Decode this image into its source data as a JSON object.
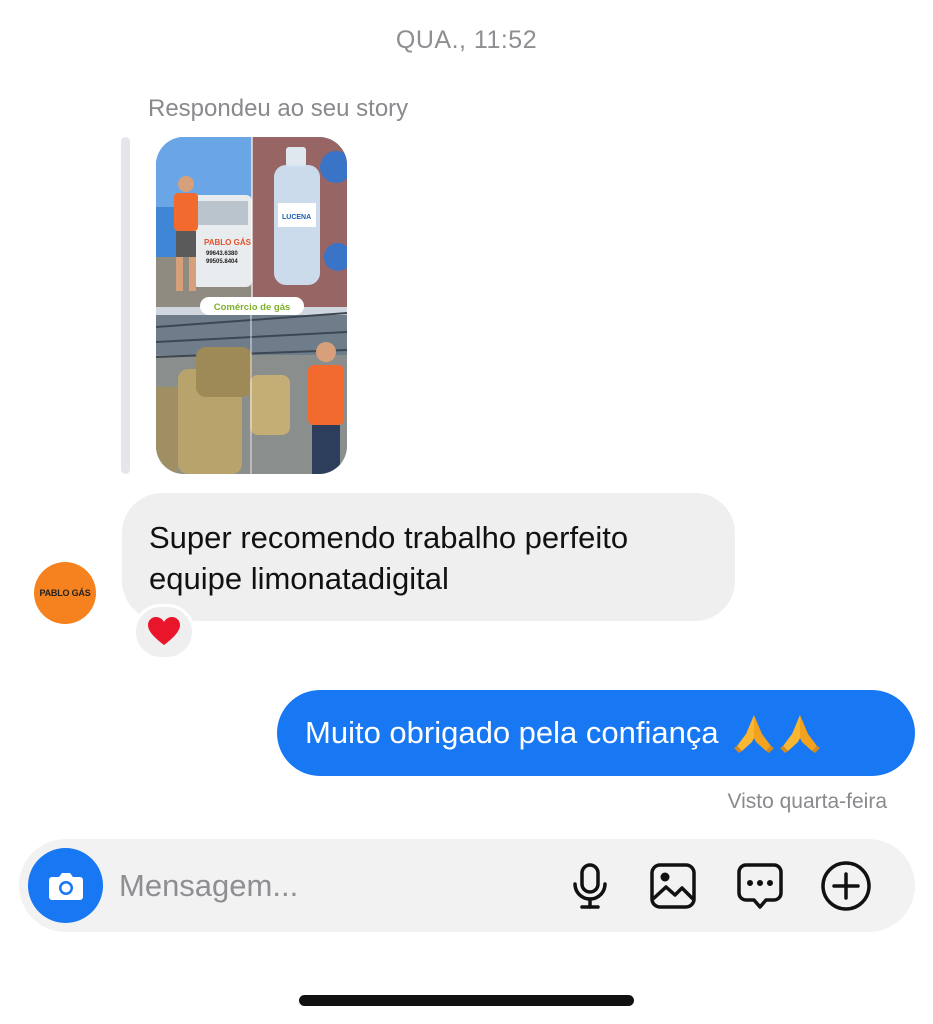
{
  "thread": {
    "timestamp": "QUA., 11:52",
    "story_reply": {
      "caption": "Respondeu ao seu story",
      "thumbnail_text": {
        "van_brand": "PABLO GÁS",
        "van_phone_1": "99643.6380",
        "van_phone_2": "99505.8404",
        "bottle_label": "LUCENA",
        "banner": "Comércio de gás"
      }
    },
    "incoming": {
      "avatar_label": "PABLO GÁS",
      "text": "Super recomendo trabalho perfeito equipe limonatadigital",
      "reaction": "heart"
    },
    "outgoing": {
      "text": "Muito obrigado pela confiança",
      "emoji": "folded-hands folded-hands",
      "status": "Visto quarta-feira"
    }
  },
  "composer": {
    "placeholder": "Mensagem...",
    "camera_icon": "camera-icon",
    "tools": [
      "microphone-icon",
      "image-icon",
      "sticker-chat-icon",
      "add-icon"
    ]
  },
  "colors": {
    "accent": "#1877f2",
    "incoming_bubble": "#efefef",
    "muted_text": "#8e8e93"
  }
}
